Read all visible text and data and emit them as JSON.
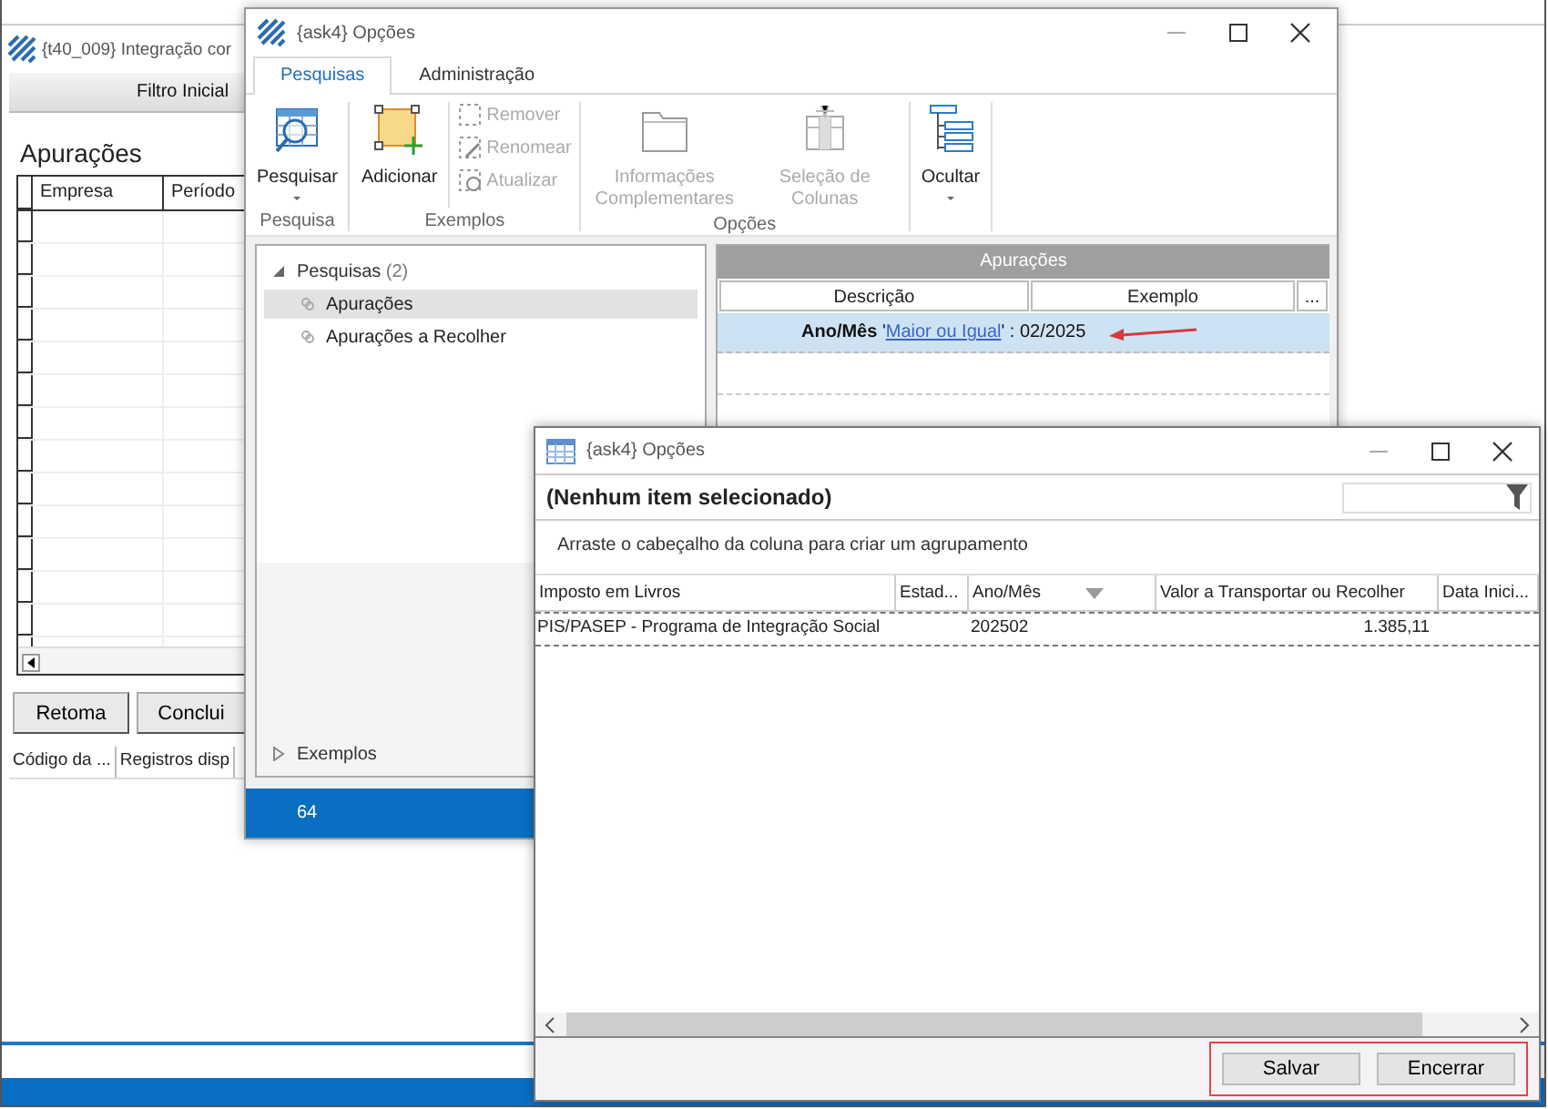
{
  "main_window": {
    "title": "{t40_009}  Integração cor",
    "filter_bar": "Filtro Inicial",
    "heading": "Apurações",
    "table": {
      "columns": [
        "Empresa",
        "Período"
      ]
    },
    "buttons": [
      "Retoma",
      "Conclui"
    ],
    "status_columns": [
      "Código da ...",
      "Registros disp"
    ]
  },
  "options_window": {
    "title": "{ask4}  Opções",
    "tabs": [
      {
        "label": "Pesquisas",
        "selected": true
      },
      {
        "label": "Administração",
        "selected": false
      }
    ],
    "ribbon_groups": [
      {
        "label": "Pesquisa",
        "items": [
          {
            "kind": "large",
            "label": "Pesquisar",
            "dropdown": true,
            "disabled": false
          }
        ]
      },
      {
        "label": "Exemplos",
        "items": [
          {
            "kind": "large",
            "label": "Adicionar",
            "disabled": false
          },
          {
            "kind": "small",
            "label": "Remover",
            "disabled": true
          },
          {
            "kind": "small",
            "label": "Renomear",
            "disabled": true
          },
          {
            "kind": "small",
            "label": "Atualizar",
            "disabled": true
          }
        ]
      },
      {
        "label": "Opções",
        "items": [
          {
            "kind": "large",
            "label": "Informações Complementares",
            "disabled": true
          },
          {
            "kind": "large",
            "label": "Seleção de Colunas",
            "disabled": true
          }
        ]
      },
      {
        "items": [
          {
            "kind": "large",
            "label": "Ocultar",
            "dropdown": true,
            "disabled": false
          }
        ]
      }
    ],
    "searches_tree": {
      "label": "Pesquisas",
      "count": "(2)",
      "expanded": true,
      "children": [
        {
          "label": "Apurações",
          "selected": true
        },
        {
          "label": "Apurações a Recolher",
          "selected": false
        }
      ]
    },
    "examples_tree": {
      "label": "Exemplos",
      "expanded": false
    },
    "grid": {
      "title": "Apurações",
      "columns": [
        "Descrição",
        "Exemplo",
        "..."
      ],
      "rows": [
        {
          "before": "**Ano/Mês** '",
          "link": "Maior ou Igual",
          "after": "' :  02/2025",
          "selected": true,
          "arrow": true
        }
      ]
    },
    "status_bar": "64"
  },
  "dialog": {
    "title": "{ask4}  Opções",
    "header": "(Nenhum item selecionado)",
    "group_hint": "Arraste o cabeçalho da coluna para criar um agrupamento",
    "columns": [
      {
        "label": "Imposto em Livros"
      },
      {
        "label": "Estad..."
      },
      {
        "label": "Ano/Mês",
        "sorted": true
      },
      {
        "label": "Valor a Transportar ou Recolher"
      },
      {
        "label": "Data Inici..."
      }
    ],
    "rows": [
      {
        "cells": [
          "PIS/PASEP - Programa de Integração Social",
          null,
          "202502",
          "1.385,11",
          null
        ]
      }
    ],
    "buttons": [
      "Salvar",
      "Encerrar"
    ],
    "buttons_highlighted": true
  }
}
